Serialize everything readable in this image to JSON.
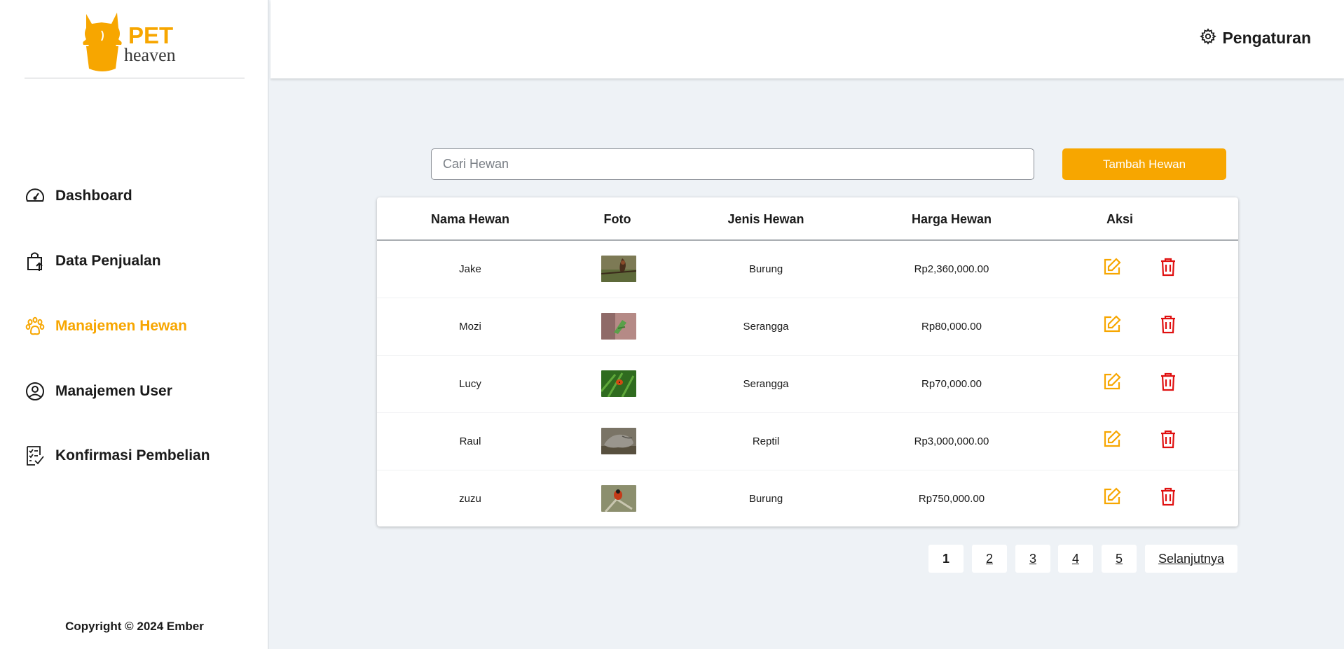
{
  "brand": {
    "logo_word1": "PET",
    "logo_word2": "heaven",
    "accent_color": "#f7a600"
  },
  "sidebar": {
    "items": [
      {
        "label": "Dashboard",
        "icon": "speedometer-icon",
        "active": false
      },
      {
        "label": "Data Penjualan",
        "icon": "shopping-bag-upload-icon",
        "active": false
      },
      {
        "label": "Manajemen Hewan",
        "icon": "paw-icon",
        "active": true
      },
      {
        "label": "Manajemen User",
        "icon": "user-circle-icon",
        "active": false
      },
      {
        "label": "Konfirmasi Pembelian",
        "icon": "checklist-icon",
        "active": false
      }
    ],
    "copyright": "Copyright © 2024 Ember"
  },
  "header": {
    "settings_label": "Pengaturan",
    "settings_icon": "gear-icon"
  },
  "toolbar": {
    "search_placeholder": "Cari Hewan",
    "search_value": "",
    "add_label": "Tambah Hewan"
  },
  "table": {
    "columns": [
      "Nama Hewan",
      "Foto",
      "Jenis Hewan",
      "Harga Hewan",
      "Aksi"
    ],
    "rows": [
      {
        "name": "Jake",
        "photo": "bird-photo",
        "type": "Burung",
        "price": "Rp2,360,000.00"
      },
      {
        "name": "Mozi",
        "photo": "insect-photo",
        "type": "Serangga",
        "price": "Rp80,000.00"
      },
      {
        "name": "Lucy",
        "photo": "ladybug-photo",
        "type": "Serangga",
        "price": "Rp70,000.00"
      },
      {
        "name": "Raul",
        "photo": "reptile-photo",
        "type": "Reptil",
        "price": "Rp3,000,000.00"
      },
      {
        "name": "zuzu",
        "photo": "bird-photo",
        "type": "Burung",
        "price": "Rp750,000.00"
      }
    ],
    "edit_icon": "edit-icon",
    "delete_icon": "trash-icon",
    "edit_color": "#f7a600",
    "delete_color": "#e01010"
  },
  "pagination": {
    "pages": [
      "1",
      "2",
      "3",
      "4",
      "5"
    ],
    "current": "1",
    "next_label": "Selanjutnya"
  }
}
